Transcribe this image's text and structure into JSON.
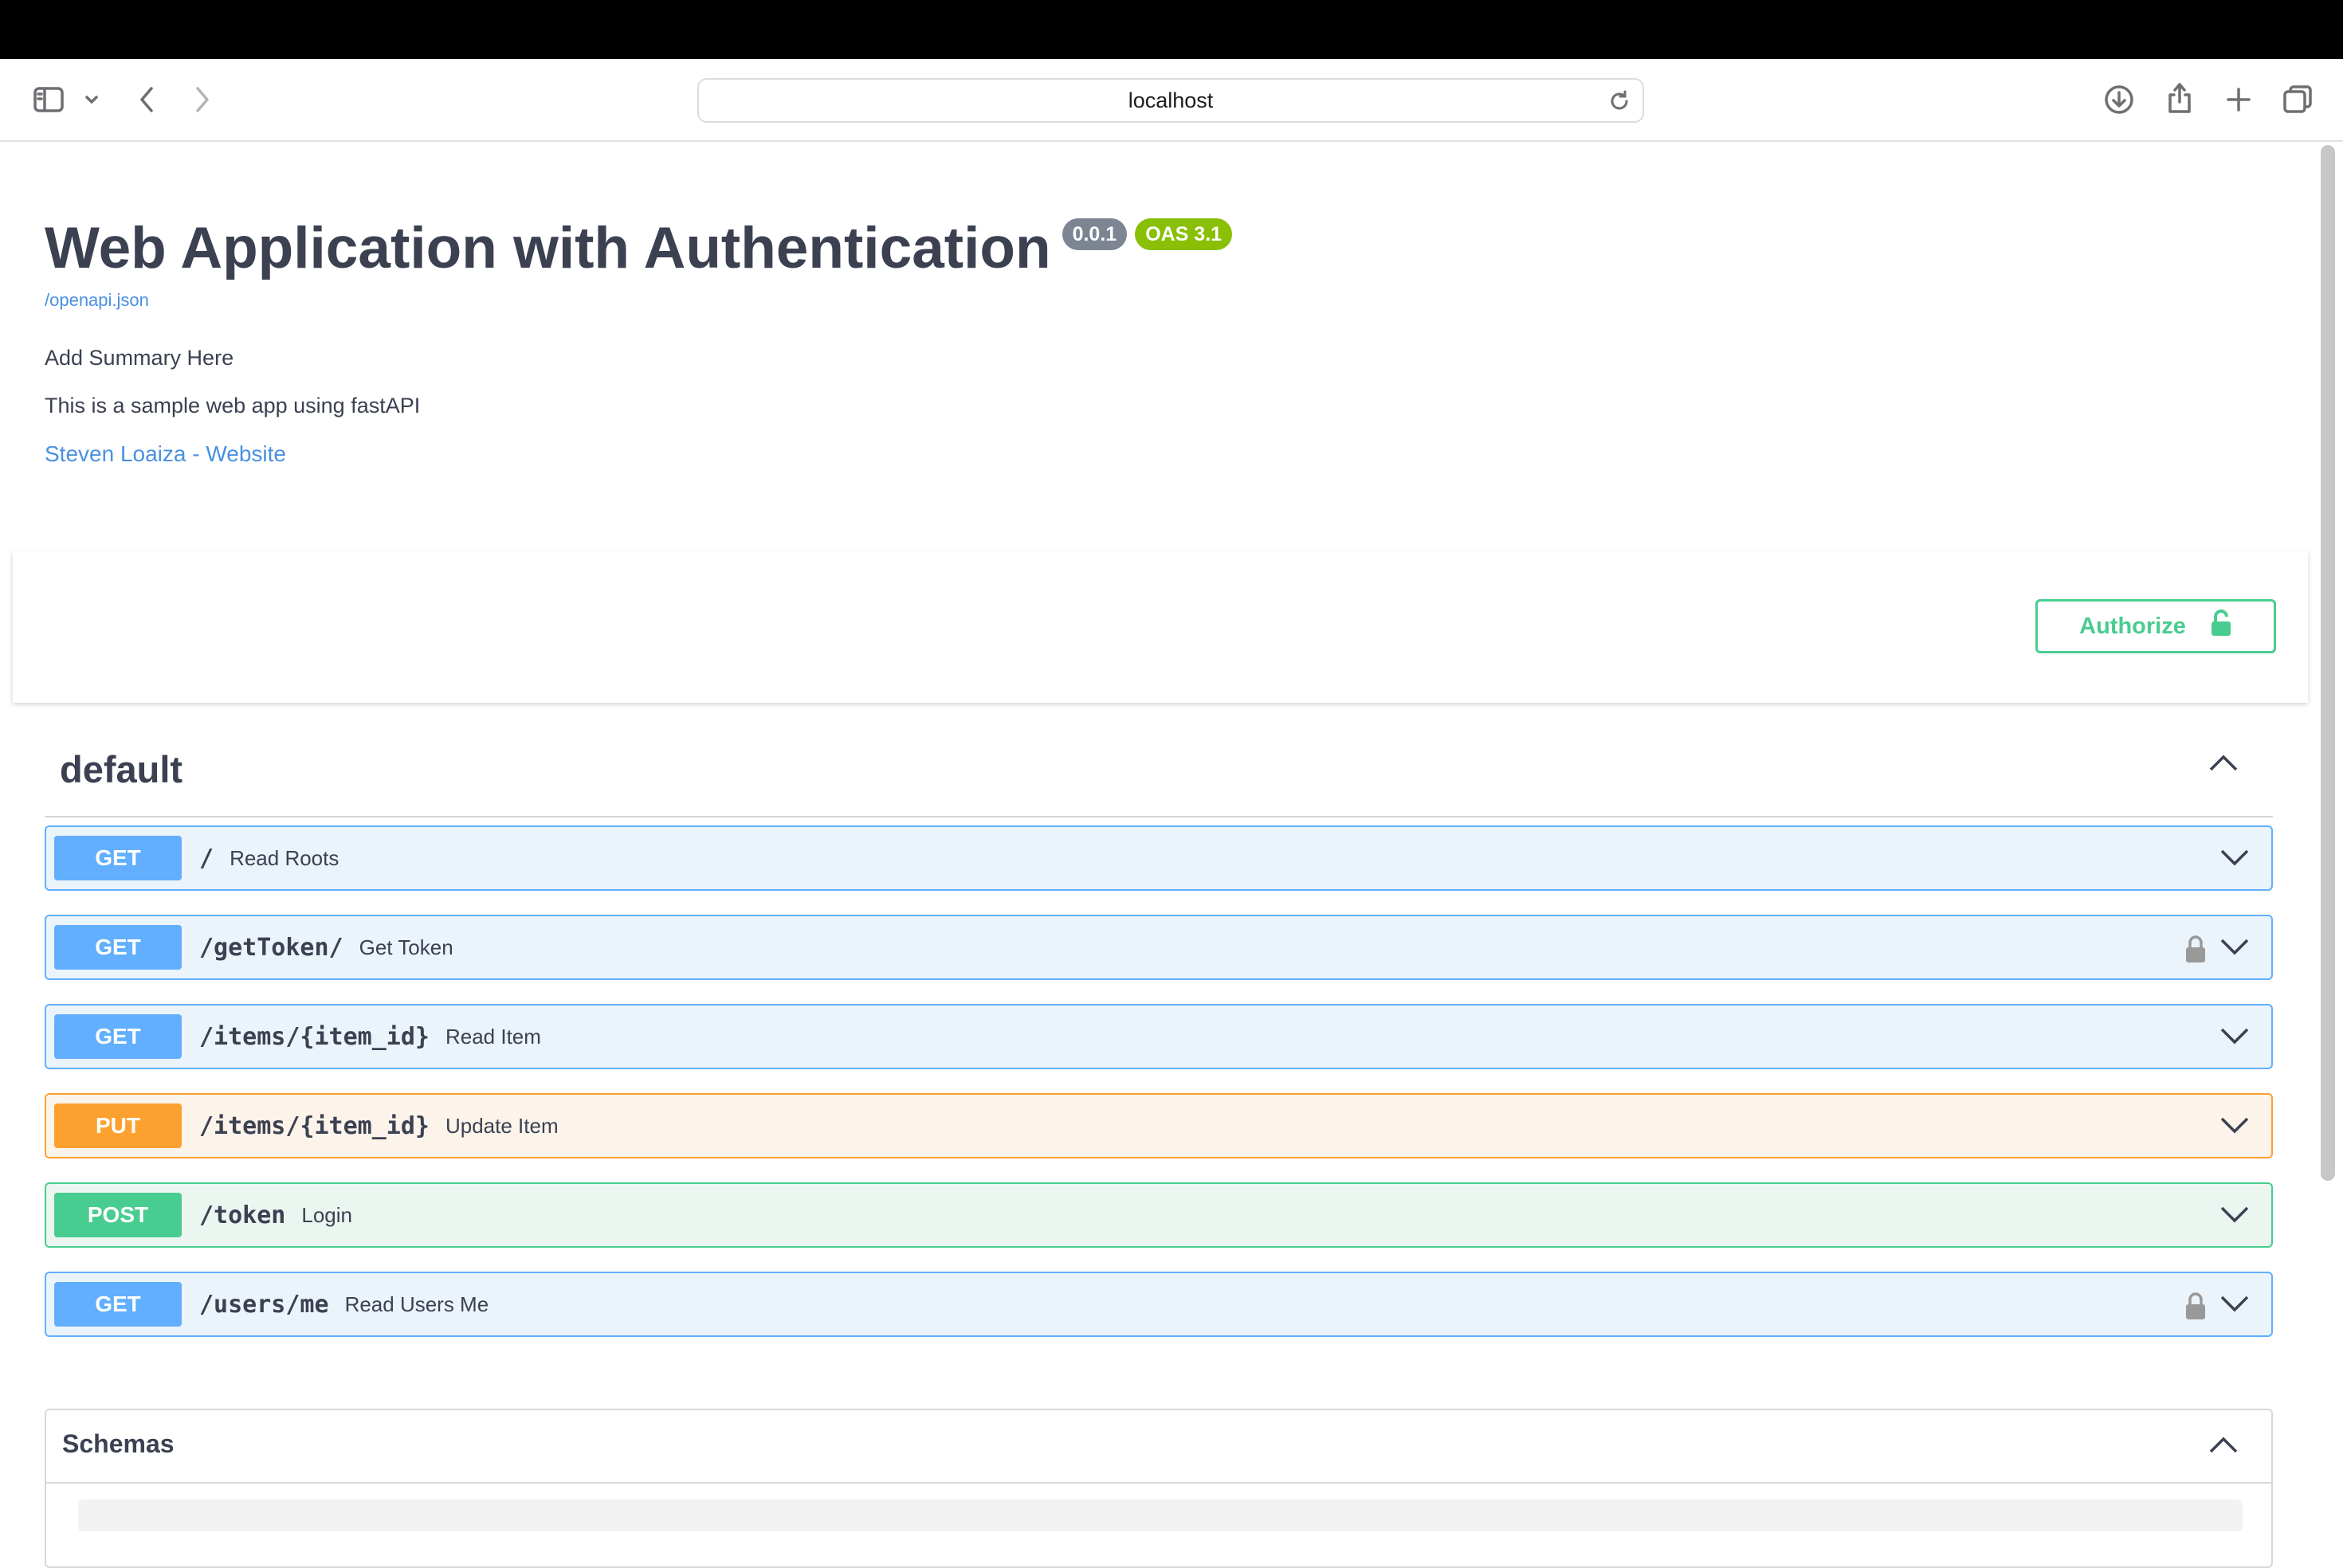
{
  "browser": {
    "address": "localhost"
  },
  "api": {
    "title": "Web Application with Authentication",
    "version_badge": "0.0.1",
    "oas_badge": "OAS 3.1",
    "spec_link": "/openapi.json",
    "summary": "Add Summary Here",
    "description": "This is a sample web app using fastAPI",
    "contact_link": "Steven Loaiza - Website"
  },
  "authorize": {
    "label": "Authorize"
  },
  "tag": {
    "name": "default"
  },
  "operations": [
    {
      "method": "GET",
      "path": "/",
      "summary": "Read Roots",
      "locked": false
    },
    {
      "method": "GET",
      "path": "/getToken/",
      "summary": "Get Token",
      "locked": true
    },
    {
      "method": "GET",
      "path": "/items/{item_id}",
      "summary": "Read Item",
      "locked": false
    },
    {
      "method": "PUT",
      "path": "/items/{item_id}",
      "summary": "Update Item",
      "locked": false
    },
    {
      "method": "POST",
      "path": "/token",
      "summary": "Login",
      "locked": false
    },
    {
      "method": "GET",
      "path": "/users/me",
      "summary": "Read Users Me",
      "locked": true
    }
  ],
  "schemas": {
    "title": "Schemas"
  },
  "colors": {
    "get": "#61affe",
    "put": "#fca130",
    "post": "#49cc90",
    "link": "#4990e2"
  }
}
